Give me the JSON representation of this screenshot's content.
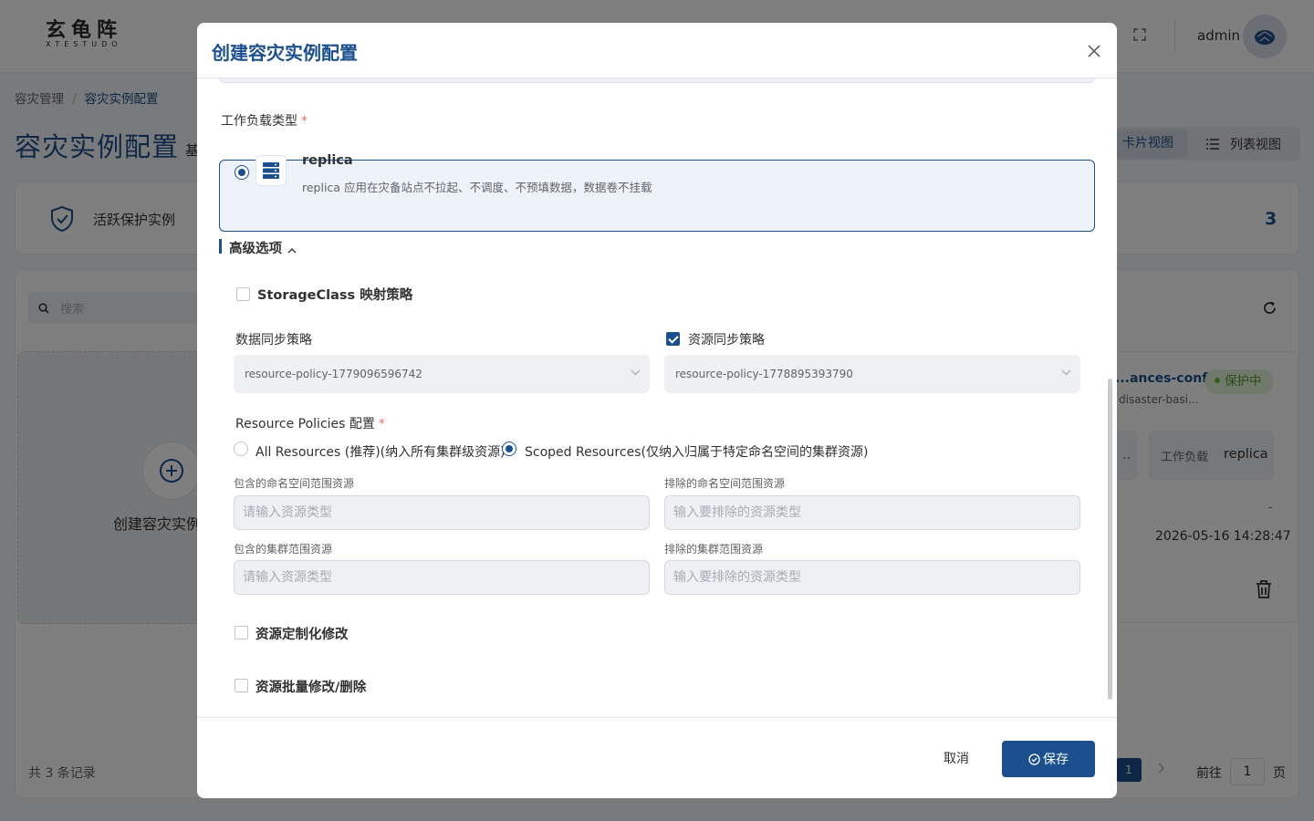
{
  "app": {
    "logo_cn": "玄龟阵",
    "logo_en": "XTESTUDO",
    "user_name": "admin"
  },
  "breadcrumb": [
    "容灾管理",
    "/",
    "容灾实例配置"
  ],
  "page": {
    "title": "容灾实例配置",
    "subtitle_fragment": "基",
    "view_card_label": "卡片视图",
    "view_list_label": "列表视图"
  },
  "stats": {
    "label": "活跃保护实例",
    "count": "3"
  },
  "search": {
    "placeholder": "搜索"
  },
  "create_card_label": "创建容灾实例",
  "instance_card": {
    "name": "...ances-conf...",
    "subtitle": "disaster-basi...",
    "status": "保护中",
    "wl_left_value": "..",
    "workload_label": "工作负载",
    "workload_value": "replica",
    "dash": "-",
    "time": "2026-05-16 14:28:47"
  },
  "pagination": {
    "total": "共 3 条记录",
    "current_page": "1",
    "next_symbol": ">",
    "goto_label": "前往",
    "goto_value": "1",
    "goto_suffix": "页"
  },
  "dialog": {
    "title": "创建容灾实例配置",
    "workload_type_label": "工作负载类型",
    "required_mark": "*",
    "workload_option": {
      "title": "replica",
      "description": "replica 应用在灾备站点不拉起、不调度、不预填数据，数据卷不挂载"
    },
    "advanced_label": "高级选项",
    "storageclass_label": "StorageClass 映射策略",
    "data_sync_label": "数据同步策略",
    "data_sync_value": "resource-policy-1779096596742",
    "resource_sync_label": "资源同步策略",
    "resource_sync_value": "resource-policy-1778895393790",
    "resource_policies_label": "Resource Policies 配置",
    "radio_all_label": "All Resources (推荐)(纳入所有集群级资源)",
    "radio_scoped_label": "Scoped Resources(仅纳入归属于特定命名空间的集群资源)",
    "include_ns_label": "包含的命名空间范围资源",
    "include_ns_placeholder": "请输入资源类型",
    "exclude_ns_label": "排除的命名空间范围资源",
    "exclude_ns_placeholder": "输入要排除的资源类型",
    "include_cluster_label": "包含的集群范围资源",
    "include_cluster_placeholder": "请输入资源类型",
    "exclude_cluster_label": "排除的集群范围资源",
    "exclude_cluster_placeholder": "输入要排除的资源类型",
    "custom_modify_label": "资源定制化修改",
    "batch_modify_label": "资源批量修改/删除",
    "cancel_label": "取消",
    "save_label": "保存"
  },
  "colors": {
    "primary": "#1c4f8e",
    "success": "#67c23a",
    "required": "#f56c6c"
  }
}
